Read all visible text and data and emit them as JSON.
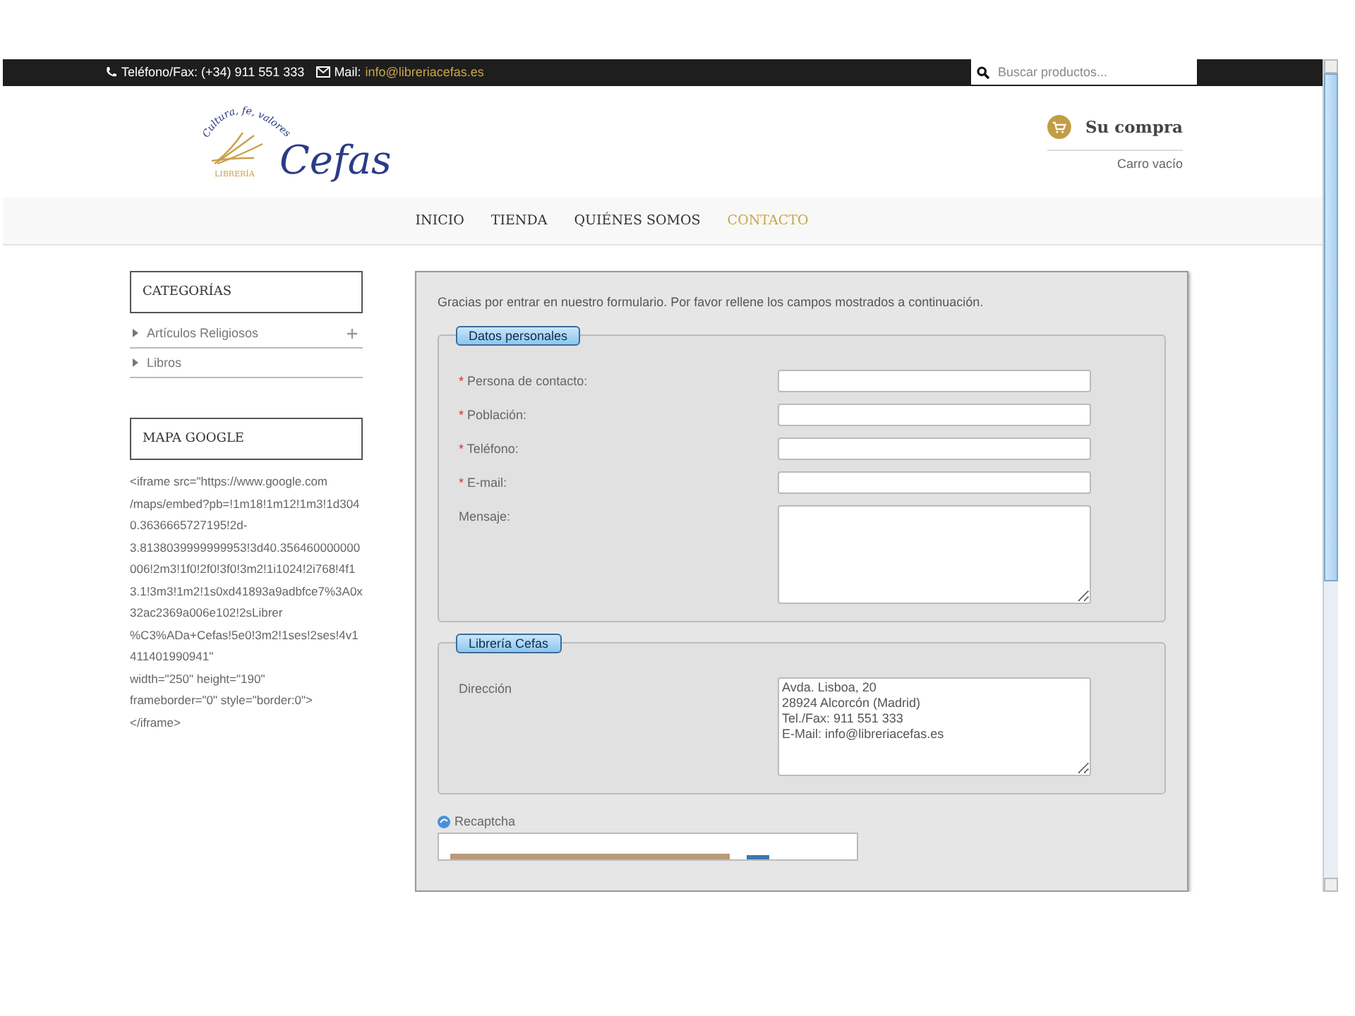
{
  "topbar": {
    "phone": "Teléfono/Fax: (+34) 911 551 333",
    "mail_label": "Mail:",
    "mail": "info@libreriacefas.es",
    "search": {
      "placeholder": "Buscar productos..."
    }
  },
  "logo": {
    "motto": "Cultura, fe, valores",
    "small": "LIBRERÍA",
    "name": "Cefas"
  },
  "cart": {
    "title": "Su compra",
    "status": "Carro vacío"
  },
  "nav": [
    {
      "label": "INICIO",
      "selected": false
    },
    {
      "label": "TIENDA",
      "selected": false
    },
    {
      "label": "QUIÉNES SOMOS",
      "selected": false
    },
    {
      "label": "CONTACTO",
      "selected": true
    }
  ],
  "sidebar": {
    "categories_title": "CATEGORÍAS",
    "categories": [
      {
        "label": "Artículos Religiosos",
        "expandable": true
      },
      {
        "label": "Libros",
        "expandable": false
      }
    ],
    "map_title": "MAPA GOOGLE",
    "map_code": [
      "<iframe src=\"https://www.google.com",
      "/maps/embed?pb=!1m18!1m12!1m3!1d3040.3636665727195!2d-",
      "3.8138039999999953!3d40.356460000000006!2m3!1f0!2f0!3f0!3m2!1i1024!2i768!4f13.1!3m3!1m2!1s0xd41893a9adbfce7%3A0x32ac2369a006e102!2sLibrer",
      "%C3%ADa+Cefas!5e0!3m2!1ses!2ses!4v1411401990941\"",
      "width=\"250\" height=\"190\"",
      "frameborder=\"0\" style=\"border:0\">",
      "</iframe>"
    ]
  },
  "form": {
    "intro": "Gracias por entrar en nuestro formulario. Por favor rellene los campos mostrados a continuación.",
    "sections": [
      {
        "legend": "Datos personales",
        "fields": [
          {
            "label": "Persona de contacto:",
            "required": true,
            "kind": "input"
          },
          {
            "label": "Población:",
            "required": true,
            "kind": "input"
          },
          {
            "label": "Teléfono:",
            "required": true,
            "kind": "input"
          },
          {
            "label": "E-mail:",
            "required": true,
            "kind": "input"
          },
          {
            "label": "Mensaje:",
            "required": false,
            "kind": "textarea"
          }
        ]
      },
      {
        "legend": "Librería Cefas",
        "fields": [
          {
            "label": "Dirección",
            "required": false,
            "kind": "textarea",
            "value": "Avda. Lisboa, 20\n28924 Alcorcón (Madrid)\nTel./Fax: 911 551 333\nE-Mail: info@libreriacefas.es"
          }
        ]
      }
    ],
    "required_mark": "*",
    "recaptcha_label": "Recaptcha"
  }
}
